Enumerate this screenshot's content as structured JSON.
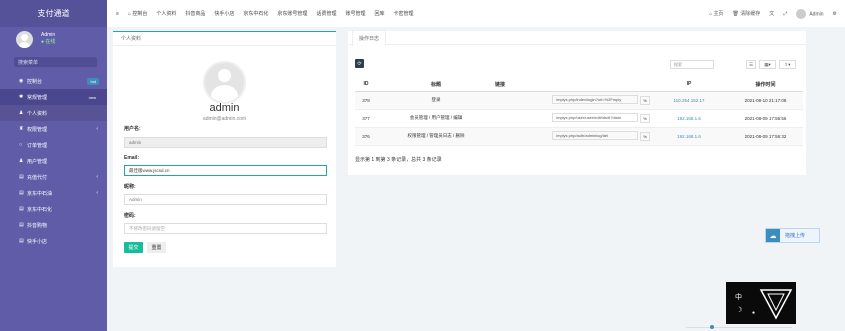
{
  "brand": "支付通道",
  "user": {
    "name": "Admin",
    "status": "● 在线"
  },
  "sidebar": {
    "search_placeholder": "搜索菜单",
    "items": [
      {
        "label": "控制台",
        "badge": "hot"
      },
      {
        "label": "常规管理",
        "badge": "new"
      },
      {
        "label": "个人资料"
      },
      {
        "label": "权限管理"
      },
      {
        "label": "订单管理"
      },
      {
        "label": "用户管理"
      },
      {
        "label": "充值代付"
      },
      {
        "label": "京东中石油"
      },
      {
        "label": "京东中石化"
      },
      {
        "label": "抖音购物"
      },
      {
        "label": "快手小店"
      }
    ]
  },
  "topnav": [
    "控制台",
    "个人资料",
    "抖音商品",
    "快手小店",
    "京东中石化",
    "京东账号管理",
    "话费管理",
    "账号管理",
    "回库",
    "卡密管理"
  ],
  "topright": {
    "home": "主页",
    "clear": "清除缓存",
    "admin": "Admin"
  },
  "profile": {
    "tab": "个人资料",
    "name": "admin",
    "email_display": "admin@admin.com",
    "username_label": "用户名:",
    "username_value": "admin",
    "email_label": "Email:",
    "email_value": "最佳版www.jscsd.cn",
    "nickname_label": "昵称:",
    "nickname_value": "Admin",
    "password_label": "密码:",
    "password_placeholder": "不修改密码请留空",
    "submit": "提交",
    "reset": "重置"
  },
  "log": {
    "tab": "操作日志",
    "search_placeholder": "搜索",
    "headers": [
      "ID",
      "标题",
      "链接",
      "IP",
      "操作时间"
    ],
    "rows": [
      {
        "id": "378",
        "title": "登录",
        "url": "/mpiys.php/index/login?url=%2Fmpiy",
        "ip": "110.254.152.17",
        "time": "2021-08-10 21:17:08"
      },
      {
        "id": "377",
        "title": "会员管理 / 用户管理 / 编辑",
        "url": "/mpiys.php/user/user/edit/ids/6?dialo",
        "ip": "192.168.1.6",
        "time": "2021-08-09 17:56:56"
      },
      {
        "id": "376",
        "title": "权限管理 / 管理员日志 / 删除",
        "url": "/mpiys.php/auth/adminlog/del",
        "ip": "192.168.1.6",
        "time": "2021-08-09 17:56:32"
      }
    ],
    "pagination": "显示第 1 到第 3 条记录，总共 3 条记录"
  },
  "float_upload": "拖拽上传",
  "black_widget": {
    "text": "中"
  },
  "colors": {
    "sidebar": "#605ca8",
    "accent": "#18bc9c",
    "link": "#3c8dbc"
  }
}
